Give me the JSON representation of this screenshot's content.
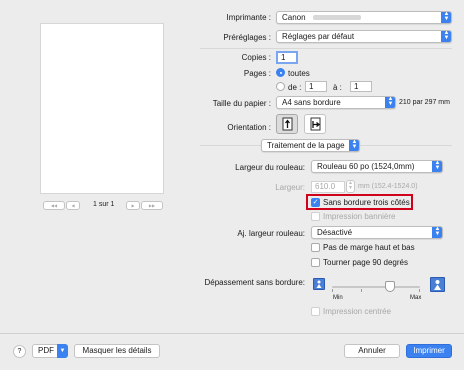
{
  "preview": {
    "page_indicator": "1 sur 1",
    "nav_first": "◀◀",
    "nav_prev": "◀",
    "nav_next": "▶",
    "nav_last": "▶▶"
  },
  "printer": {
    "label": "Imprimante :",
    "value": "Canon"
  },
  "presets": {
    "label": "Préréglages :",
    "value": "Réglages par défaut"
  },
  "copies": {
    "label": "Copies :",
    "value": "1"
  },
  "pages": {
    "label": "Pages :",
    "all_label": "toutes",
    "from_label": "de :",
    "from_value": "1",
    "to_label": "à :",
    "to_value": "1"
  },
  "paper_size": {
    "label": "Taille du papier :",
    "value": "A4 sans bordure",
    "dimensions": "210 par 297 mm"
  },
  "orientation": {
    "label": "Orientation :"
  },
  "section_popup": {
    "value": "Traitement de la page"
  },
  "roll_width": {
    "label": "Largeur du rouleau:",
    "value": "Rouleau 60 po (1524,0mm)"
  },
  "width": {
    "label": "Largeur:",
    "value": "610.0",
    "range": "mm (152.4-1524.0)"
  },
  "borderless_three_sides": {
    "label": "Sans bordure trois côtés",
    "checked": true
  },
  "banner_print": {
    "label": "Impression bannière",
    "checked": false
  },
  "adjust_roll_width": {
    "label": "Aj. largeur rouleau:",
    "value": "Désactivé"
  },
  "no_top_bottom_margin": {
    "label": "Pas de marge haut et bas",
    "checked": false
  },
  "rotate_90": {
    "label": "Tourner page 90 degrés",
    "checked": false
  },
  "borderless_overflow": {
    "label": "Dépassement sans bordure:",
    "min_label": "Min",
    "max_label": "Max",
    "level": 0.75
  },
  "center_print": {
    "label": "Impression centrée",
    "checked": false
  },
  "bottom": {
    "help": "?",
    "pdf": "PDF",
    "details": "Masquer les détails",
    "cancel": "Annuler",
    "print": "Imprimer"
  },
  "colors": {
    "accent": "#3b82f0",
    "highlight_border": "#d0021b"
  }
}
